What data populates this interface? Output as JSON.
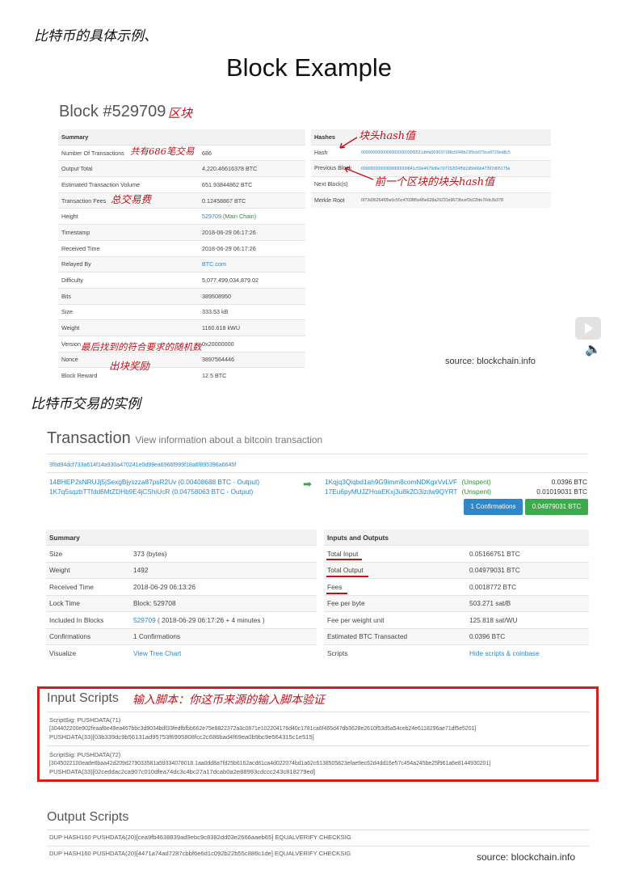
{
  "handnotes": {
    "top_heading": "比特币的具体示例、",
    "block_mark": "区块",
    "num_tx": "共有686笔交易",
    "fees": "总交易费",
    "hashes_mark": "块头hash值",
    "prev_mark": "前一个区块的块头hash值",
    "nonce": "最后找到的符合要求的随机数",
    "reward": "出块奖励",
    "tx_heading": "比特币交易的实例",
    "input_scripts": "输入脚本：你这币来源的输入脚本验证"
  },
  "page_title": "Block Example",
  "block": {
    "title": "Block #529709",
    "summary_header": "Summary",
    "rows": [
      {
        "label": "Number Of Transactions",
        "value": "686"
      },
      {
        "label": "Output Total",
        "value": "4,220.46616378 BTC"
      },
      {
        "label": "Estimated Transaction Volume",
        "value": "651.93844862 BTC"
      },
      {
        "label": "Transaction Fees",
        "value": "0.12458867 BTC"
      },
      {
        "label": "Height",
        "value": "529709",
        "extra": " (Main Chain)"
      },
      {
        "label": "Timestamp",
        "value": "2018-06-29 06:17:26"
      },
      {
        "label": "Received Time",
        "value": "2018-06-29 06:17:26"
      },
      {
        "label": "Relayed By",
        "value": "BTC.com"
      },
      {
        "label": "Difficulty",
        "value": "5,077,499,034,879.02"
      },
      {
        "label": "Bits",
        "value": "389508950"
      },
      {
        "label": "Size",
        "value": "333.53 kB"
      },
      {
        "label": "Weight",
        "value": "1160.618 kWU"
      },
      {
        "label": "Version",
        "value": "0x20000000"
      },
      {
        "label": "Nonce",
        "value": "3897564446"
      },
      {
        "label": "Block Reward",
        "value": "12.5 BTC"
      }
    ],
    "hashes_header": "Hashes",
    "hashes": [
      {
        "label": "Hash",
        "value": "0000000000000000000030f1531dbfa069037188c5048b23f0cb979ce8729ed8c5"
      },
      {
        "label": "Previous Block",
        "value": "00000000000000000000841c59e4679d6e707152f24f5b195b66b47397d65175e"
      },
      {
        "label": "Next Block(s)",
        "value": ""
      },
      {
        "label": "Merkle Root",
        "value": "6f73d36264f05e0c55c4703f85e85e628a29231e9673bcef3c02bfe76dc2b378"
      }
    ]
  },
  "source_label": "source: blockchain.info",
  "tx": {
    "title": "Transaction",
    "subtitle": "View information about a bitcoin transaction",
    "hash": "3f8d94dcf733a614f14a930a470241e0d99ea6966f999f18a6f895396a6645f",
    "inputs": [
      "14BHEP2sNRUJj5jSexgBjyszza87psR2Uv (0.00408688 BTC - Output)",
      "1K7q5sqzbTTfdd6MtZDHb9E4jCShiUcR (0.04758063 BTC - Output)"
    ],
    "outputs": [
      {
        "address": "1Kqjq3Qiqbd1ah9G9imm8comNDKgxVvLVF",
        "status": "(Unspent)",
        "amount": "0.0396 BTC"
      },
      {
        "address": "17Eu6pyMUJZHoaEKxj3u8k2D3izdw9QYRT",
        "status": "(Unspent)",
        "amount": "0.01019031 BTC"
      }
    ],
    "confirm_button": "1 Confirmations",
    "total_button": "0.04979031 BTC",
    "summary_header": "Summary",
    "summary": [
      {
        "label": "Size",
        "value": "373 (bytes)"
      },
      {
        "label": "Weight",
        "value": "1492"
      },
      {
        "label": "Received Time",
        "value": "2018-06-29 06:13:26"
      },
      {
        "label": "Lock Time",
        "value": "Block: 529708"
      },
      {
        "label": "Included In Blocks",
        "value": "529709",
        "extra": " ( 2018-06-29 06:17:26 + 4 minutes )"
      },
      {
        "label": "Confirmations",
        "value": "1 Confirmations"
      },
      {
        "label": "Visualize",
        "value": "View Tree Chart"
      }
    ],
    "io_header": "Inputs and Outputs",
    "io": [
      {
        "label": "Total Input",
        "value": "0.05166751 BTC"
      },
      {
        "label": "Total Output",
        "value": "0.04979031 BTC"
      },
      {
        "label": "Fees",
        "value": "0.0018772 BTC"
      },
      {
        "label": "Fee per byte",
        "value": "503.271 sat/B"
      },
      {
        "label": "Fee per weight unit",
        "value": "125.818 sat/WU"
      },
      {
        "label": "Estimated BTC Transacted",
        "value": "0.0396 BTC"
      },
      {
        "label": "Scripts",
        "value": "Hide scripts & coinbase"
      }
    ]
  },
  "input_scripts": {
    "title": "Input Scripts",
    "blocks": [
      [
        "ScriptSig: PUSHDATA(71)",
        "[304402200e902feaaf8e49ea467bbc3d9034bdf33fedfbfbb662e75e8822372a3c0871e102204176d40c1781ca6f465d47db3628e2610f53d5a54ceb24e6118296ae71df5e5201]",
        "PUSHDATA(33)[03b339dc9b56131ad95753f6995808fcc2c686bad4f69ea0b9bc9e564315c1e515]"
      ],
      [
        "ScriptSig: PUSHDATA(72)",
        "[3045022100eade6baa42d209d279033581a59334078018 1aa0dd8a7fd25b6162acd81ca4d022074bd1a62c6138505823efae9ec62d4dd16e57c454a245be25f961a6e8144930201]",
        "PUSHDATA(33)[02ceddac2ca907c010dfea74dc3c4bc27a17dcab0a2e88993cdccc243c818279ed]"
      ]
    ]
  },
  "output_scripts": {
    "title": "Output Scripts",
    "lines": [
      "DUP HASH160 PUSHDATA(20)[cea9fb4638839ad9ebc9c8382dd03e2666aaeb65] EQUALVERIFY CHECKSIG",
      "DUP HASH160 PUSHDATA(20)[4471a74ad7287cbbf6e6d1c092b22b55c886c1de] EQUALVERIFY CHECKSIG"
    ]
  }
}
